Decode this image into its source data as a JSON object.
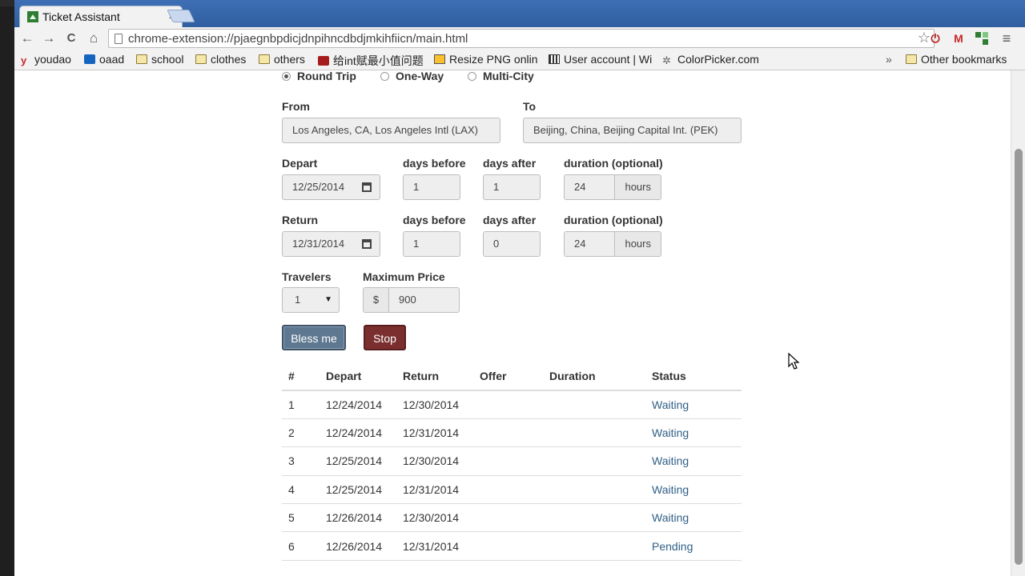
{
  "browser": {
    "tab_title": "Ticket Assistant",
    "tab_close": "×",
    "url": "chrome-extension://pjaegnbpdicjdnpihncdbdjmkihfiicn/main.html",
    "star": "☆",
    "nav": {
      "back": "←",
      "forward": "→",
      "reload": "C",
      "home": "⌂"
    },
    "extensions": {
      "power": "⏻",
      "gmail": "M",
      "menu": "≡"
    }
  },
  "bookmarks": [
    {
      "label": "youdao",
      "icon": "youdao-icon"
    },
    {
      "label": "oaad",
      "icon": "outlook-icon"
    },
    {
      "label": "school",
      "icon": "folder-icon"
    },
    {
      "label": "clothes",
      "icon": "folder-icon"
    },
    {
      "label": "others",
      "icon": "folder-icon"
    },
    {
      "label": "给int赋最小值问题",
      "icon": "c-icon"
    },
    {
      "label": "Resize PNG online",
      "icon": "resize-icon"
    },
    {
      "label": "User account | Wi",
      "icon": "user-icon"
    },
    {
      "label": "ColorPicker.com",
      "icon": "color-picker-icon"
    }
  ],
  "bookmarks_overflow": "»",
  "other_bookmarks": "Other bookmarks",
  "form": {
    "trip_types": [
      {
        "label": "Round Trip",
        "selected": true
      },
      {
        "label": "One-Way",
        "selected": false
      },
      {
        "label": "Multi-City",
        "selected": false
      }
    ],
    "from_label": "From",
    "from_value": "Los Angeles, CA, Los Angeles Intl (LAX)",
    "to_label": "To",
    "to_value": "Beijing, China, Beijing Capital Int. (PEK)",
    "depart": {
      "label": "Depart",
      "date": "12/25/2014",
      "days_before_label": "days before",
      "days_before": "1",
      "days_after_label": "days after",
      "days_after": "1",
      "duration_label": "duration (optional)",
      "duration": "24",
      "duration_unit": "hours"
    },
    "return": {
      "label": "Return",
      "date": "12/31/2014",
      "days_before_label": "days before",
      "days_before": "1",
      "days_after_label": "days after",
      "days_after": "0",
      "duration_label": "duration (optional)",
      "duration": "24",
      "duration_unit": "hours"
    },
    "travelers_label": "Travelers",
    "travelers_value": "1",
    "max_price_label": "Maximum Price",
    "currency": "$",
    "max_price": "900",
    "bless_button": "Bless me",
    "stop_button": "Stop"
  },
  "results": {
    "headers": [
      "#",
      "Depart",
      "Return",
      "Offer",
      "Duration",
      "Status"
    ],
    "rows": [
      {
        "num": "1",
        "depart": "12/24/2014",
        "return": "12/30/2014",
        "offer": "",
        "duration": "",
        "status": "Waiting"
      },
      {
        "num": "2",
        "depart": "12/24/2014",
        "return": "12/31/2014",
        "offer": "",
        "duration": "",
        "status": "Waiting"
      },
      {
        "num": "3",
        "depart": "12/25/2014",
        "return": "12/30/2014",
        "offer": "",
        "duration": "",
        "status": "Waiting"
      },
      {
        "num": "4",
        "depart": "12/25/2014",
        "return": "12/31/2014",
        "offer": "",
        "duration": "",
        "status": "Waiting"
      },
      {
        "num": "5",
        "depart": "12/26/2014",
        "return": "12/30/2014",
        "offer": "",
        "duration": "",
        "status": "Waiting"
      },
      {
        "num": "6",
        "depart": "12/26/2014",
        "return": "12/31/2014",
        "offer": "",
        "duration": "",
        "status": "Pending"
      }
    ]
  },
  "colors": {
    "accent_status": "#2f5f86",
    "bless_button": "#5e7891",
    "stop_button": "#7a2e2e",
    "tabstrip": "#3e6fb5"
  }
}
